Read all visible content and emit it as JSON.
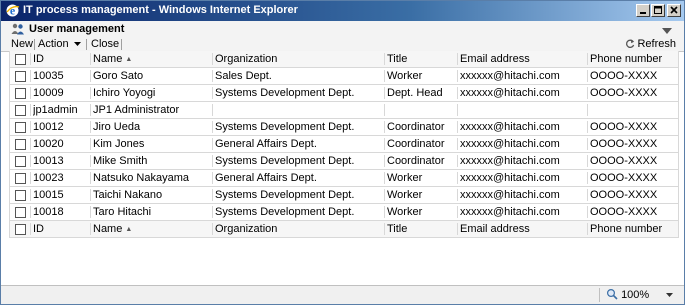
{
  "window": {
    "title": "IT process management - Windows Internet Explorer"
  },
  "header": {
    "title": "User management"
  },
  "toolbar": {
    "new_label": "New",
    "action_label": "Action",
    "close_label": "Close",
    "refresh_label": "Refresh"
  },
  "table": {
    "columns": {
      "id": "ID",
      "name": "Name",
      "organization": "Organization",
      "title": "Title",
      "email": "Email address",
      "phone": "Phone number"
    },
    "rows": [
      {
        "id": "10035",
        "name": "Goro Sato",
        "organization": "Sales Dept.",
        "title": "Worker",
        "email": "xxxxxx@hitachi.com",
        "phone": "OOOO-XXXX"
      },
      {
        "id": "10009",
        "name": "Ichiro Yoyogi",
        "organization": "Systems Development Dept.",
        "title": "Dept. Head",
        "email": "xxxxxx@hitachi.com",
        "phone": "OOOO-XXXX"
      },
      {
        "id": "jp1admin",
        "name": "JP1 Administrator",
        "organization": "",
        "title": "",
        "email": "",
        "phone": ""
      },
      {
        "id": "10012",
        "name": "Jiro Ueda",
        "organization": "Systems Development Dept.",
        "title": "Coordinator",
        "email": "xxxxxx@hitachi.com",
        "phone": "OOOO-XXXX"
      },
      {
        "id": "10020",
        "name": "Kim Jones",
        "organization": "General Affairs Dept.",
        "title": "Coordinator",
        "email": "xxxxxx@hitachi.com",
        "phone": "OOOO-XXXX"
      },
      {
        "id": "10013",
        "name": "Mike Smith",
        "organization": "Systems Development Dept.",
        "title": "Coordinator",
        "email": "xxxxxx@hitachi.com",
        "phone": "OOOO-XXXX"
      },
      {
        "id": "10023",
        "name": "Natsuko Nakayama",
        "organization": "General Affairs Dept.",
        "title": "Worker",
        "email": "xxxxxx@hitachi.com",
        "phone": "OOOO-XXXX"
      },
      {
        "id": "10015",
        "name": "Taichi Nakano",
        "organization": "Systems Development Dept.",
        "title": "Worker",
        "email": "xxxxxx@hitachi.com",
        "phone": "OOOO-XXXX"
      },
      {
        "id": "10018",
        "name": "Taro Hitachi",
        "organization": "Systems Development Dept.",
        "title": "Worker",
        "email": "xxxxxx@hitachi.com",
        "phone": "OOOO-XXXX"
      }
    ]
  },
  "statusbar": {
    "zoom": "100%"
  },
  "icons": {
    "browser": "ie-icon",
    "users": "people-icon",
    "refresh": "refresh-icon",
    "zoom": "magnifier-icon"
  },
  "colors": {
    "titlebar_start": "#0a246a",
    "titlebar_end": "#a6caf0",
    "toolbar_bg": "#f3f3f3",
    "grid_line": "#d8d8d8"
  }
}
